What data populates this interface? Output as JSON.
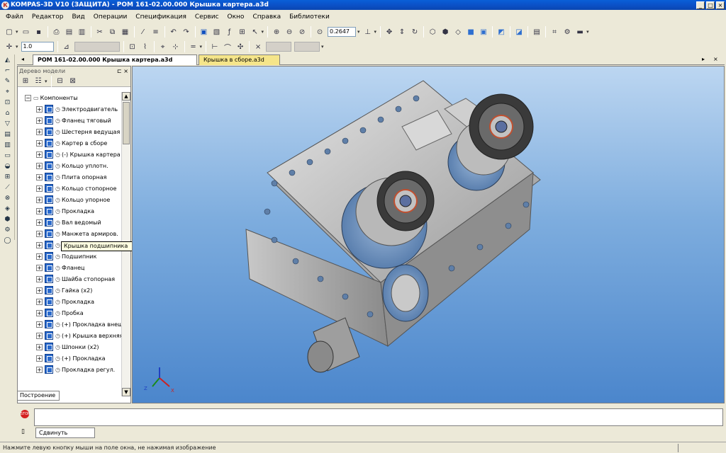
{
  "window": {
    "title": "KOMPAS-3D V10 (ЗАЩИТА) - POM 161-02.00.000 Крышка картера.a3d",
    "app_icon": "К"
  },
  "menu": [
    "Файл",
    "Редактор",
    "Вид",
    "Операции",
    "Спецификация",
    "Сервис",
    "Окно",
    "Справка",
    "Библиотеки"
  ],
  "toolbar": {
    "zoom_value": "0.2647",
    "scale_value": "1.0"
  },
  "tabs": {
    "active": "POM 161-02.00.000 Крышка картера.a3d",
    "second": "Крышка в сборе.a3d"
  },
  "tree": {
    "header": "Дерево модели",
    "root": "Компоненты",
    "items": [
      {
        "label": "Электродвигатель"
      },
      {
        "label": "Фланец тяговый"
      },
      {
        "label": "Шестерня ведущая"
      },
      {
        "label": "Картер в сборе"
      },
      {
        "label": "(-) Крышка картера"
      },
      {
        "label": "Кольцо уплотн."
      },
      {
        "label": "Плита опорная"
      },
      {
        "label": "Кольцо стопорное"
      },
      {
        "label": "Кольцо упорное"
      },
      {
        "label": "Прокладка"
      },
      {
        "label": "Вал ведомый"
      },
      {
        "label": "Манжета армиров."
      },
      {
        "label": "Крышка подшипника"
      },
      {
        "label": "Подшипник"
      },
      {
        "label": "Фланец"
      },
      {
        "label": "Шайба стопорная"
      },
      {
        "label": "Гайка (x2)"
      },
      {
        "label": "Прокладка"
      },
      {
        "label": "Пробка"
      },
      {
        "label": "(+) Прокладка внеш."
      },
      {
        "label": "(+) Крышка верхняя"
      },
      {
        "label": "Шпонки (x2)"
      },
      {
        "label": "(+) Прокладка"
      },
      {
        "label": "Прокладка регул."
      }
    ],
    "tooltip": "Крышка подшипника",
    "tab_label": "Построение"
  },
  "bottom": {
    "create_label": "Сдвинуть",
    "stop_label": "STOP"
  },
  "status": "Нажмите левую кнопку мыши на поле окна, не нажимая изображение"
}
